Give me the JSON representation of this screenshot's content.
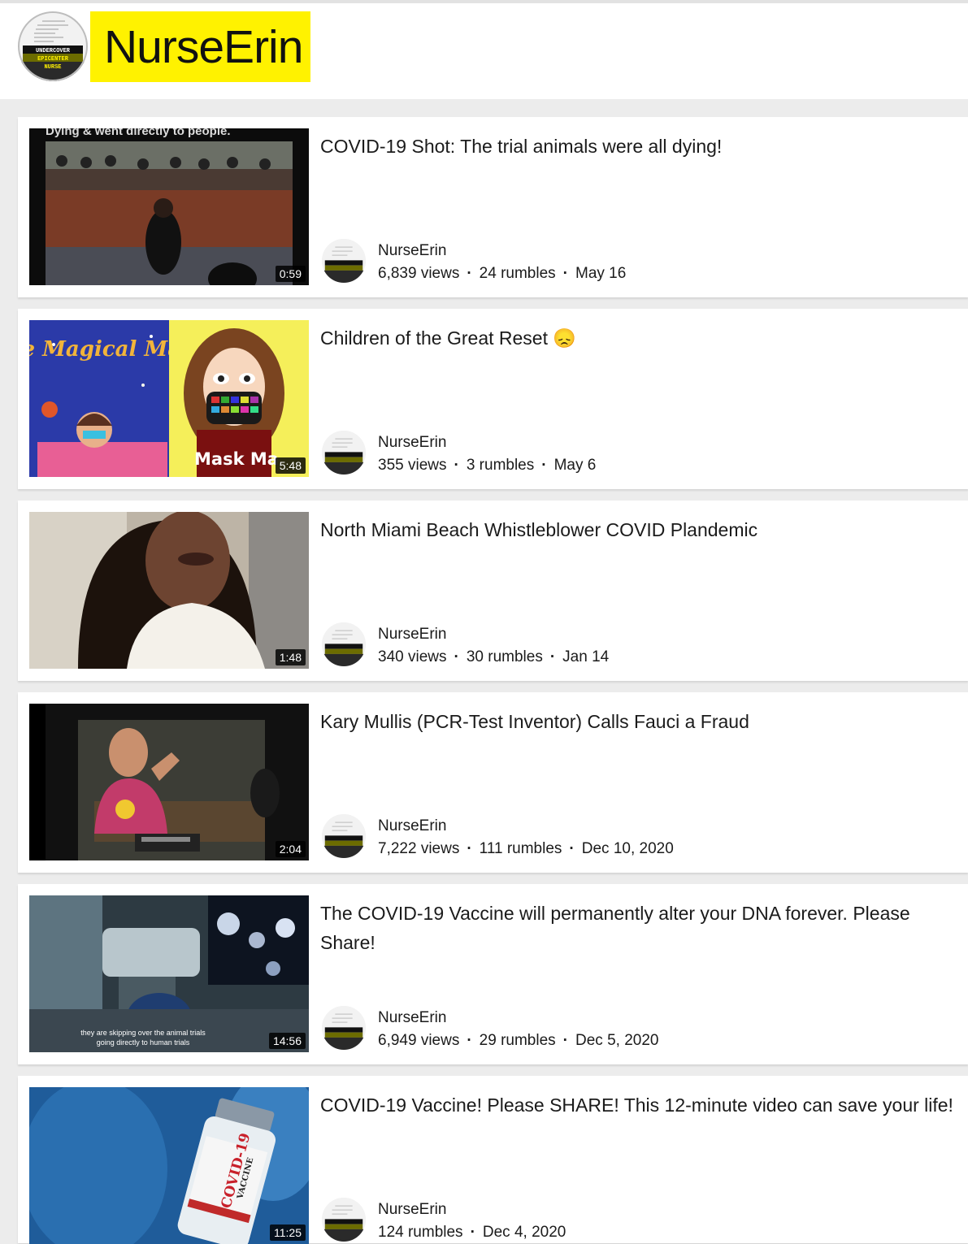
{
  "channel": {
    "name": "NurseErin",
    "avatar_caption": "UNDERCOVER EPICENTER NURSE"
  },
  "videos": [
    {
      "title": "COVID-19 Shot: The trial animals were all dying!",
      "duration": "0:59",
      "channel": "NurseErin",
      "views": "6,839 views",
      "rumbles": "24 rumbles",
      "date": "May 16"
    },
    {
      "title": "Children of the Great Reset 😞",
      "duration": "5:48",
      "channel": "NurseErin",
      "views": "355 views",
      "rumbles": "3 rumbles",
      "date": "May 6",
      "thumb_text_1": "The Magical Mask",
      "thumb_text_2": "Mask Ma"
    },
    {
      "title": "North Miami Beach Whistleblower COVID Plandemic",
      "duration": "1:48",
      "channel": "NurseErin",
      "views": "340 views",
      "rumbles": "30 rumbles",
      "date": "Jan 14"
    },
    {
      "title": "Kary Mullis (PCR-Test Inventor) Calls Fauci a Fraud",
      "duration": "2:04",
      "channel": "NurseErin",
      "views": "7,222 views",
      "rumbles": "111 rumbles",
      "date": "Dec 10, 2020"
    },
    {
      "title": "The COVID-19 Vaccine will permanently alter your DNA forever. Please Share!",
      "duration": "14:56",
      "channel": "NurseErin",
      "views": "6,949 views",
      "rumbles": "29 rumbles",
      "date": "Dec 5, 2020",
      "thumb_caption": "they are skipping over the animal trials going directly to human trials"
    },
    {
      "title": "COVID-19 Vaccine! Please SHARE! This 12-minute video can save your life!",
      "duration": "11:25",
      "channel": "NurseErin",
      "rumbles": "124 rumbles",
      "date": "Dec 4, 2020",
      "thumb_text_1": "COVID-19",
      "thumb_text_2": "VACCINE"
    }
  ],
  "colors": {
    "channel_highlight": "#fff200",
    "card_background": "#ffffff",
    "page_background": "#ececec"
  }
}
